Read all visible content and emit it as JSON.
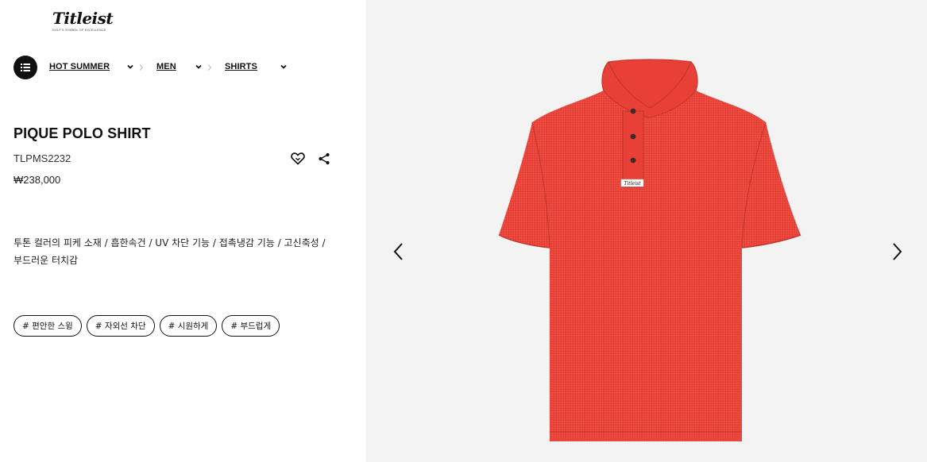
{
  "brand": {
    "logo_text": "Titleist",
    "tagline": "GOLF'S SYMBOL OF EXCELLENCE",
    "trademark": "®"
  },
  "breadcrumb": [
    {
      "label": "HOT SUMMER"
    },
    {
      "label": "MEN"
    },
    {
      "label": "SHIRTS"
    }
  ],
  "product": {
    "name": "PIQUE POLO SHIRT",
    "code": "TLPMS2232",
    "price": "₩238,000",
    "description": "투톤 컬러의 피케 소재 / 흡한속건 / UV 차단 기능 / 접촉냉감 기능 / 고신축성 / 부드러운 터치감",
    "tags": [
      "# 편안한 스윙",
      "# 자외선 차단",
      "# 시원하게",
      "# 부드럽게"
    ],
    "label_text": "Titleist",
    "color": "#e9453a"
  },
  "icons": {
    "menu": "list-menu-icon",
    "wishlist": "heart-icon",
    "share": "share-icon",
    "prev": "chevron-left-icon",
    "next": "chevron-right-icon",
    "dropdown": "chevron-down-icon"
  },
  "colors": {
    "gallery_bg": "#f3f3f3",
    "text": "#111111",
    "shirt": "#e9453a"
  }
}
